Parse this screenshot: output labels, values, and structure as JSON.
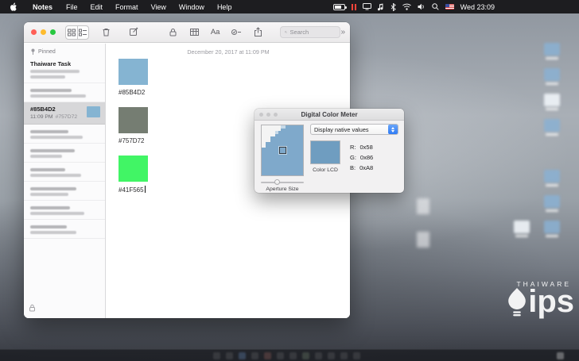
{
  "menu_bar": {
    "app_menu": "Notes",
    "menus": [
      "File",
      "Edit",
      "Format",
      "View",
      "Window",
      "Help"
    ],
    "status_time": "Wed 23:09"
  },
  "notes_window": {
    "toolbar": {
      "search_placeholder": "Search",
      "format_label": "Aa",
      "overflow_label": "»"
    },
    "sidebar": {
      "pinned_label": "Pinned",
      "first_note_title": "Thaiware Task",
      "selected_note": {
        "title": "#85B4D2",
        "time": "11:09 PM",
        "preview": "#757D72",
        "thumb_color": "#85B4D2"
      }
    },
    "note_content": {
      "date": "December 20, 2017 at 11:09 PM",
      "swatches": [
        {
          "label": "#85B4D2",
          "color": "#85B4D2"
        },
        {
          "label": "#757D72",
          "color": "#757D72"
        },
        {
          "label": "#41F565",
          "color": "#41F565"
        }
      ]
    }
  },
  "color_meter": {
    "title": "Digital Color Meter",
    "mode_dropdown": "Display native values",
    "display_name": "Color LCD",
    "channels": [
      {
        "label": "R:",
        "value": "0x58"
      },
      {
        "label": "G:",
        "value": "0x86"
      },
      {
        "label": "B:",
        "value": "0xA8"
      }
    ],
    "aperture_label": "Aperture Size",
    "preview_color": "#6F9DC0",
    "magnified_color": "#7FA9CB"
  },
  "watermark": {
    "brand": "THAIWARE",
    "logo_text": "ips"
  }
}
